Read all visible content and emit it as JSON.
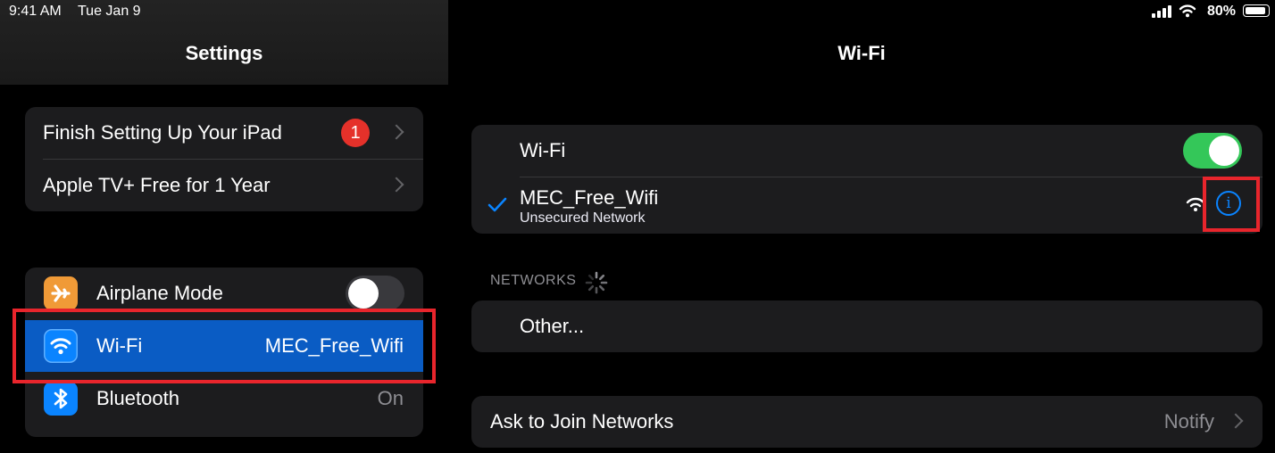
{
  "status_bar": {
    "time": "9:41 AM",
    "date": "Tue Jan 9",
    "battery": "80%"
  },
  "sidebar": {
    "title": "Settings",
    "setup_group": [
      {
        "label": "Finish Setting Up Your iPad",
        "badge": "1"
      },
      {
        "label": "Apple TV+ Free for 1 Year"
      }
    ],
    "connectivity_group": [
      {
        "label": "Airplane Mode",
        "icon": "airplane-icon",
        "toggle": false,
        "icon_color": "#f09a37"
      },
      {
        "label": "Wi-Fi",
        "icon": "wifi-icon",
        "value": "MEC_Free_Wifi",
        "selected": true,
        "icon_color": "#0a84ff"
      },
      {
        "label": "Bluetooth",
        "icon": "bluetooth-icon",
        "value": "On",
        "icon_color": "#0a84ff"
      }
    ]
  },
  "detail": {
    "title": "Wi-Fi",
    "wifi_toggle_label": "Wi-Fi",
    "wifi_enabled": true,
    "connected_network": {
      "name": "MEC_Free_Wifi",
      "subtitle": "Unsecured Network"
    },
    "networks_header": "NETWORKS",
    "other_label": "Other...",
    "ask_to_join": {
      "label": "Ask to Join Networks",
      "value": "Notify"
    }
  },
  "colors": {
    "accent_blue": "#0a84ff",
    "selected_row": "#0a5cc4",
    "toggle_on": "#34c759",
    "highlight_red": "#e8252c",
    "badge_red": "#e5312a"
  }
}
